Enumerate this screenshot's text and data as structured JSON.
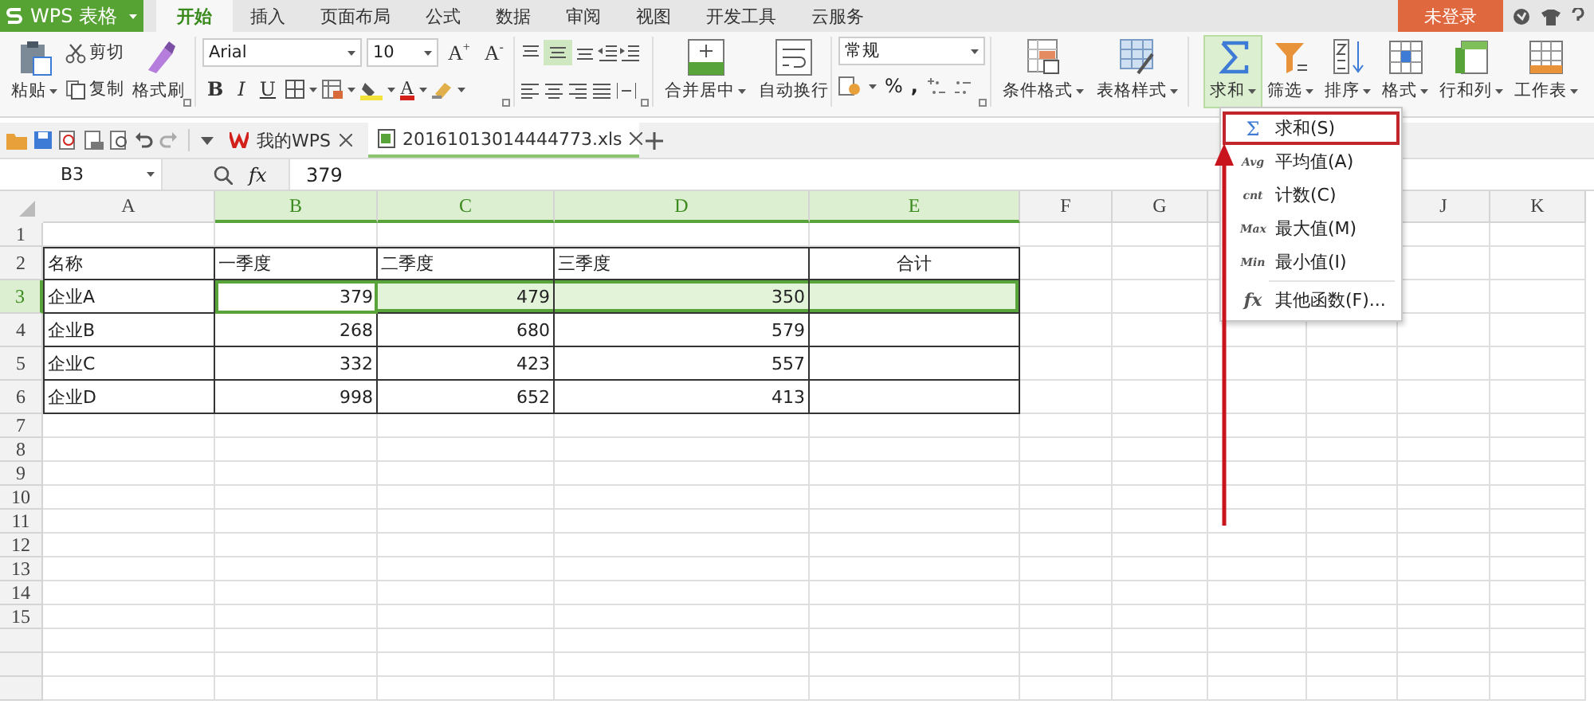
{
  "app": {
    "name": "WPS 表格"
  },
  "menu_tabs": [
    {
      "label": "开始",
      "selected": true
    },
    {
      "label": "插入",
      "selected": false
    },
    {
      "label": "页面布局",
      "selected": false
    },
    {
      "label": "公式",
      "selected": false
    },
    {
      "label": "数据",
      "selected": false
    },
    {
      "label": "审阅",
      "selected": false
    },
    {
      "label": "视图",
      "selected": false
    },
    {
      "label": "开发工具",
      "selected": false
    },
    {
      "label": "云服务",
      "selected": false
    }
  ],
  "login_button": "未登录",
  "ribbon": {
    "clipboard": {
      "paste": "粘贴",
      "cut": "剪切",
      "copy": "复制",
      "format_painter": "格式刷"
    },
    "font": {
      "family": "Arial",
      "size": "10",
      "size_buttons": [
        "A$^{+}$",
        "A$^{-}$"
      ],
      "style_buttons": [
        "B",
        "I",
        "U"
      ],
      "color_letter": "A"
    },
    "alignment": {
      "merge": "合并居中",
      "wrap": "自动换行"
    },
    "number": {
      "format": "常规",
      "percent": "%",
      "comma": ","
    },
    "styles": [
      "条件格式",
      "表格样式"
    ],
    "tools": [
      {
        "label": "求和",
        "selected": true
      },
      {
        "label": "筛选",
        "selected": false
      },
      {
        "label": "排序",
        "selected": false
      },
      {
        "label": "格式",
        "selected": false
      },
      {
        "label": "行和列",
        "selected": false
      },
      {
        "label": "工作表",
        "selected": false
      }
    ]
  },
  "doc_tabs": [
    {
      "label": "我的WPS",
      "selected": false
    },
    {
      "label": "20161013014444773.xls",
      "selected": true
    }
  ],
  "formula_bar": {
    "cell": "B3",
    "fx": "fx",
    "value": "379"
  },
  "sheet": {
    "columns": [
      {
        "label": "A",
        "highlighted": false
      },
      {
        "label": "B",
        "highlighted": true
      },
      {
        "label": "C",
        "highlighted": true
      },
      {
        "label": "D",
        "highlighted": true
      },
      {
        "label": "E",
        "highlighted": true
      },
      {
        "label": "F",
        "highlighted": false
      },
      {
        "label": "G",
        "highlighted": false
      },
      {
        "label": "J",
        "highlighted": false
      },
      {
        "label": "K",
        "highlighted": false
      }
    ],
    "rows": [
      {
        "label": "1",
        "kind": "blank",
        "highlighted": false
      },
      {
        "label": "2",
        "kind": "header",
        "highlighted": false,
        "cells": [
          "名称",
          "一季度",
          "二季度",
          "三季度",
          "合计"
        ]
      },
      {
        "label": "3",
        "kind": "data",
        "highlighted": true,
        "cells": [
          "企业A",
          "379",
          "479",
          "350"
        ]
      },
      {
        "label": "4",
        "kind": "data",
        "highlighted": false,
        "cells": [
          "企业B",
          "268",
          "680",
          "579"
        ]
      },
      {
        "label": "5",
        "kind": "data",
        "highlighted": false,
        "cells": [
          "企业C",
          "332",
          "423",
          "557"
        ]
      },
      {
        "label": "6",
        "kind": "data",
        "highlighted": false,
        "cells": [
          "企业D",
          "998",
          "652",
          "413"
        ]
      },
      {
        "label": "7",
        "kind": "blank",
        "highlighted": false
      },
      {
        "label": "8",
        "kind": "blank",
        "highlighted": false
      },
      {
        "label": "9",
        "kind": "blank",
        "highlighted": false
      },
      {
        "label": "10",
        "kind": "blank",
        "highlighted": false
      },
      {
        "label": "11",
        "kind": "blank",
        "highlighted": false
      },
      {
        "label": "12",
        "kind": "blank",
        "highlighted": false
      },
      {
        "label": "13",
        "kind": "blank",
        "highlighted": false
      },
      {
        "label": "14",
        "kind": "blank",
        "highlighted": false
      },
      {
        "label": "15",
        "kind": "blank",
        "highlighted": false
      }
    ]
  },
  "sum_menu": [
    {
      "icon": "Σ",
      "label": "求和(S)",
      "highlighted": true
    },
    {
      "icon": "Avg",
      "label": "平均值(A)",
      "highlighted": false
    },
    {
      "icon": "cnt",
      "label": "计数(C)",
      "highlighted": false
    },
    {
      "icon": "Max",
      "label": "最大值(M)",
      "highlighted": false
    },
    {
      "icon": "Min",
      "label": "最小值(I)",
      "highlighted": false
    },
    {
      "icon": "fx",
      "label": "其他函数(F)...",
      "highlighted": false
    }
  ]
}
